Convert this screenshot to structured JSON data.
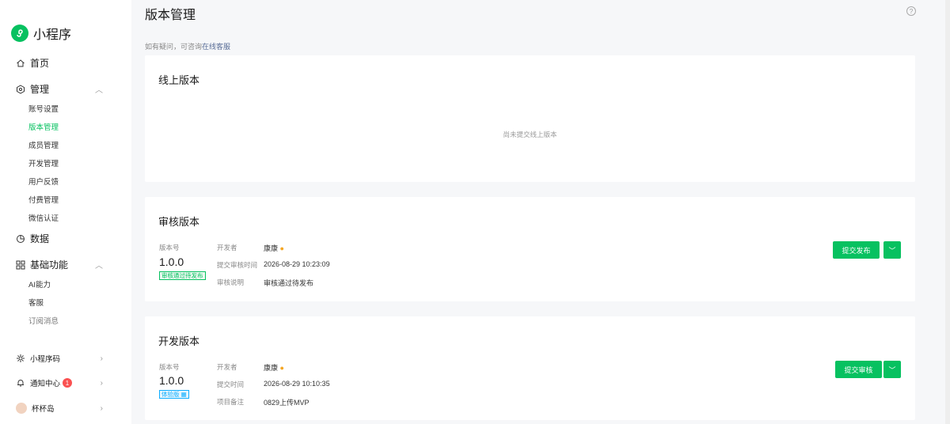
{
  "app": {
    "brand": "小程序"
  },
  "sidebar": {
    "home": "首页",
    "manage": "管理",
    "manage_items": [
      "账号设置",
      "版本管理",
      "成员管理",
      "开发管理",
      "用户反馈",
      "付费管理",
      "微信认证"
    ],
    "data": "数据",
    "basic": "基础功能",
    "basic_items": [
      "AI能力",
      "客服",
      "订阅消息"
    ],
    "qrcode": "小程序码",
    "notify": "通知中心",
    "notify_count": "1",
    "user": "杯杯岛"
  },
  "header": {
    "title": "版本管理",
    "hint_prefix": "如有疑问，可咨询",
    "hint_link": "在线客服"
  },
  "online": {
    "title": "线上版本",
    "empty": "尚未提交线上版本"
  },
  "review": {
    "title": "审核版本",
    "version_label": "版本号",
    "version": "1.0.0",
    "tag": "审核通过待发布",
    "dev_label": "开发者",
    "dev": "康康",
    "time_label": "提交审核时间",
    "time": "2026-08-29 10:23:09",
    "note_label": "审核说明",
    "note": "审核通过待发布",
    "button": "提交发布"
  },
  "dev": {
    "title": "开发版本",
    "version_label": "版本号",
    "version": "1.0.0",
    "tag": "体验版",
    "dev_label": "开发者",
    "dev": "康康",
    "time_label": "提交时间",
    "time": "2026-08-29 10:10:35",
    "note_label": "项目备注",
    "note": "0829上传MVP",
    "button": "提交审核"
  },
  "colors": {
    "accent": "#07c160",
    "link": "#576b95",
    "badge": "#fa5151",
    "info": "#10aeff"
  }
}
